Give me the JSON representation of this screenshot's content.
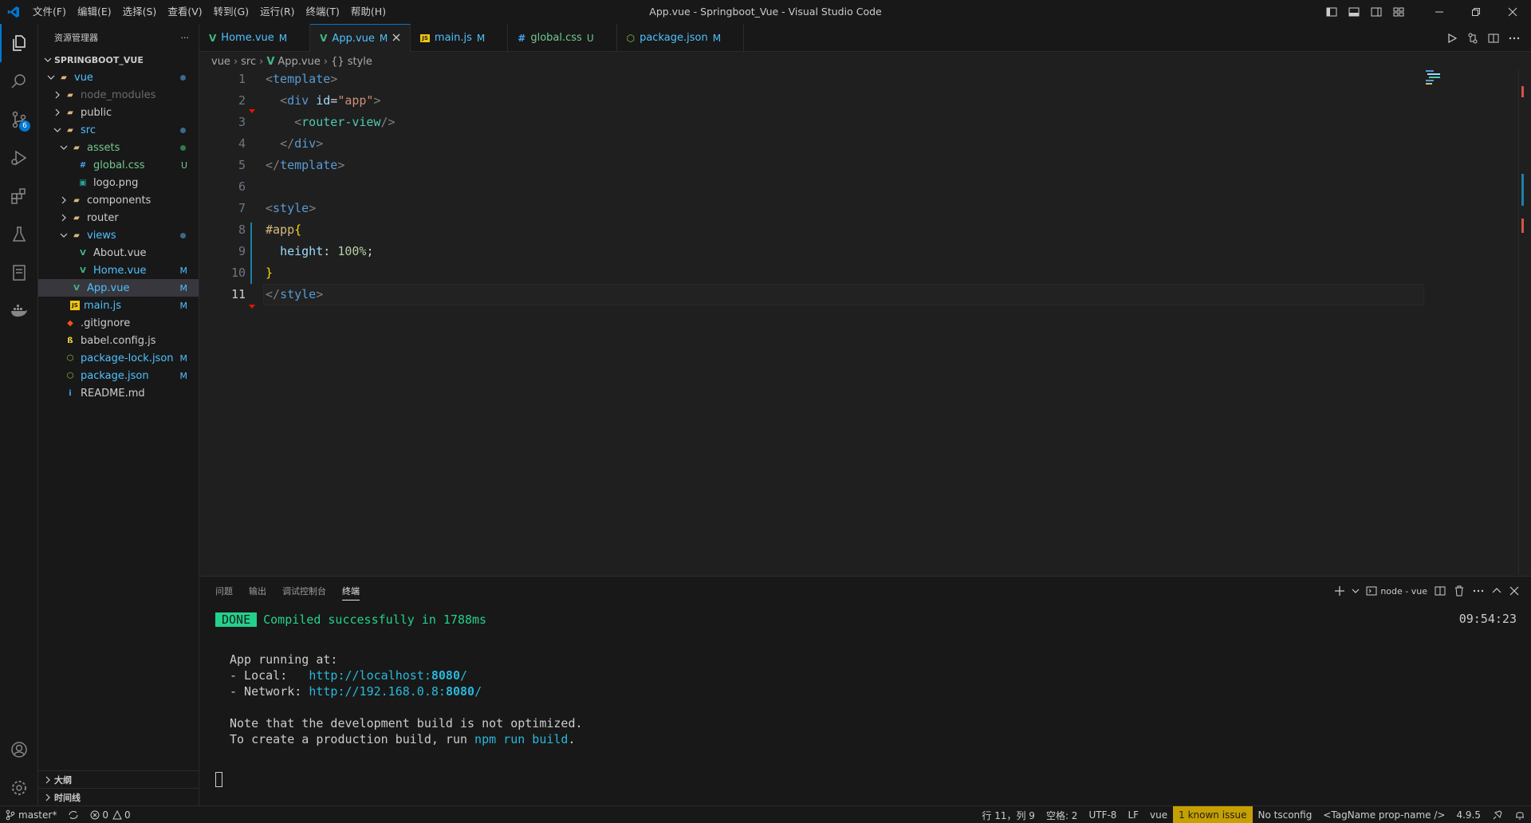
{
  "window": {
    "title": "App.vue - Springboot_Vue - Visual Studio Code"
  },
  "menu": [
    "文件(F)",
    "编辑(E)",
    "选择(S)",
    "查看(V)",
    "转到(G)",
    "运行(R)",
    "终端(T)",
    "帮助(H)"
  ],
  "activity": {
    "scm_badge": "6"
  },
  "sidebar": {
    "title": "资源管理器",
    "more": "···",
    "root": "SPRINGBOOT_VUE",
    "tree": [
      {
        "label": "vue",
        "indent": 1,
        "kind": "folder-open",
        "status": "",
        "color": "#4fc1ff"
      },
      {
        "label": "node_modules",
        "indent": 2,
        "kind": "folder",
        "status": "",
        "color": "#6b6b6b"
      },
      {
        "label": "public",
        "indent": 2,
        "kind": "folder",
        "status": "",
        "color": "#cccccc"
      },
      {
        "label": "src",
        "indent": 2,
        "kind": "folder-open",
        "status": "",
        "color": "#4fc1ff"
      },
      {
        "label": "assets",
        "indent": 3,
        "kind": "folder-open",
        "status": "",
        "color": "#73c991"
      },
      {
        "label": "global.css",
        "indent": 4,
        "kind": "css",
        "status": "U",
        "color": "#73c991"
      },
      {
        "label": "logo.png",
        "indent": 4,
        "kind": "png",
        "status": "",
        "color": "#cccccc"
      },
      {
        "label": "components",
        "indent": 3,
        "kind": "folder",
        "status": "",
        "color": "#cccccc"
      },
      {
        "label": "router",
        "indent": 3,
        "kind": "folder",
        "status": "",
        "color": "#cccccc"
      },
      {
        "label": "views",
        "indent": 3,
        "kind": "folder-open",
        "status": "",
        "color": "#4fc1ff"
      },
      {
        "label": "About.vue",
        "indent": 4,
        "kind": "vue",
        "status": "",
        "color": "#cccccc"
      },
      {
        "label": "Home.vue",
        "indent": 4,
        "kind": "vue",
        "status": "M",
        "color": "#4fc1ff"
      },
      {
        "label": "App.vue",
        "indent": 3,
        "kind": "vue",
        "status": "M",
        "color": "#4fc1ff",
        "selected": true
      },
      {
        "label": "main.js",
        "indent": 3,
        "kind": "js",
        "status": "M",
        "color": "#4fc1ff"
      },
      {
        "label": ".gitignore",
        "indent": 2,
        "kind": "git",
        "status": "",
        "color": "#cccccc"
      },
      {
        "label": "babel.config.js",
        "indent": 2,
        "kind": "babel",
        "status": "",
        "color": "#cccccc"
      },
      {
        "label": "package-lock.json",
        "indent": 2,
        "kind": "node",
        "status": "M",
        "color": "#4fc1ff"
      },
      {
        "label": "package.json",
        "indent": 2,
        "kind": "node",
        "status": "M",
        "color": "#4fc1ff"
      },
      {
        "label": "README.md",
        "indent": 2,
        "kind": "info",
        "status": "",
        "color": "#cccccc"
      }
    ],
    "outline": "大纲",
    "timeline": "时间线"
  },
  "tabs": [
    {
      "label": "Home.vue",
      "kind": "vue",
      "status": "M",
      "active": false
    },
    {
      "label": "App.vue",
      "kind": "vue",
      "status": "M",
      "active": true
    },
    {
      "label": "main.js",
      "kind": "js",
      "status": "M",
      "active": false
    },
    {
      "label": "global.css",
      "kind": "css",
      "status": "U",
      "active": false
    },
    {
      "label": "package.json",
      "kind": "node",
      "status": "M",
      "active": false
    }
  ],
  "breadcrumb": [
    "vue",
    "src",
    "App.vue",
    "{} style"
  ],
  "editor": {
    "line_numbers": [
      "1",
      "2",
      "3",
      "4",
      "5",
      "6",
      "7",
      "8",
      "9",
      "10",
      "11"
    ],
    "current_line": "11"
  },
  "panel": {
    "tabs": [
      "问题",
      "输出",
      "调试控制台",
      "终端"
    ],
    "terminal_name": "node - vue",
    "time": "09:54:23",
    "done_label": "DONE",
    "compiled": "Compiled successfully in 1788ms",
    "app_running": "App running at:",
    "local_label": "- Local:   ",
    "local_url_pre": "http://localhost:",
    "local_port": "8080",
    "network_label": "- Network: ",
    "network_url_pre": "http://192.168.0.8:",
    "network_port": "8080",
    "url_slash": "/",
    "note1": "Note that the development build is not optimized.",
    "note2_pre": "To create a production build, run ",
    "note2_cmd": "npm run build",
    "note2_post": "."
  },
  "status": {
    "branch": "master*",
    "errors": "0",
    "warnings": "0",
    "position": "行 11，列 9",
    "spaces": "空格: 2",
    "encoding": "UTF-8",
    "eol": "LF",
    "language": "vue",
    "known_issue": "1 known issue",
    "tsconfig": "No tsconfig",
    "tagname": "<TagName prop-name />",
    "version": "4.9.5"
  }
}
